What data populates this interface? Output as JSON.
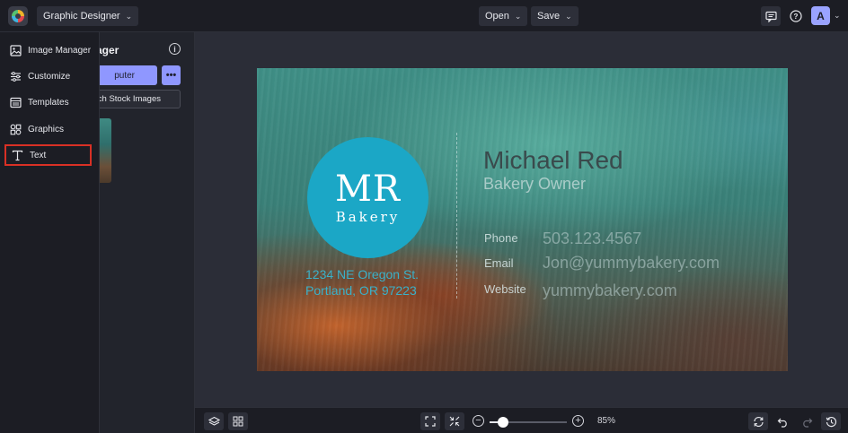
{
  "topbar": {
    "app_mode": "Graphic Designer",
    "open_label": "Open",
    "save_label": "Save",
    "avatar_initial": "A"
  },
  "sidebar": {
    "items": [
      {
        "label": "Image Manager",
        "icon": "image-icon"
      },
      {
        "label": "Customize",
        "icon": "sliders-icon"
      },
      {
        "label": "Templates",
        "icon": "templates-icon"
      },
      {
        "label": "Graphics",
        "icon": "graphics-icon"
      },
      {
        "label": "Text",
        "icon": "text-icon",
        "highlighted": true
      }
    ]
  },
  "panel": {
    "title_visible": "ager",
    "upload_visible": "puter",
    "stock_visible": "ch Stock Images",
    "more_label": "•••",
    "info": "i"
  },
  "card": {
    "logo_initials": "MR",
    "logo_word": "Bakery",
    "address_line1": "1234 NE Oregon St.",
    "address_line2": "Portland, OR 97223",
    "name": "Michael Red",
    "role": "Bakery Owner",
    "contacts": [
      {
        "label": "Phone",
        "value": "503.123.4567"
      },
      {
        "label": "Email",
        "value": "Jon@yummybakery.com"
      },
      {
        "label": "Website",
        "value": "yummybakery.com"
      }
    ]
  },
  "bottombar": {
    "zoom_label": "85%",
    "zoom_level": 0.18
  },
  "colors": {
    "accent": "#8f97ff",
    "highlight_border": "#d93025",
    "logo_circle": "#1ba7c6"
  }
}
